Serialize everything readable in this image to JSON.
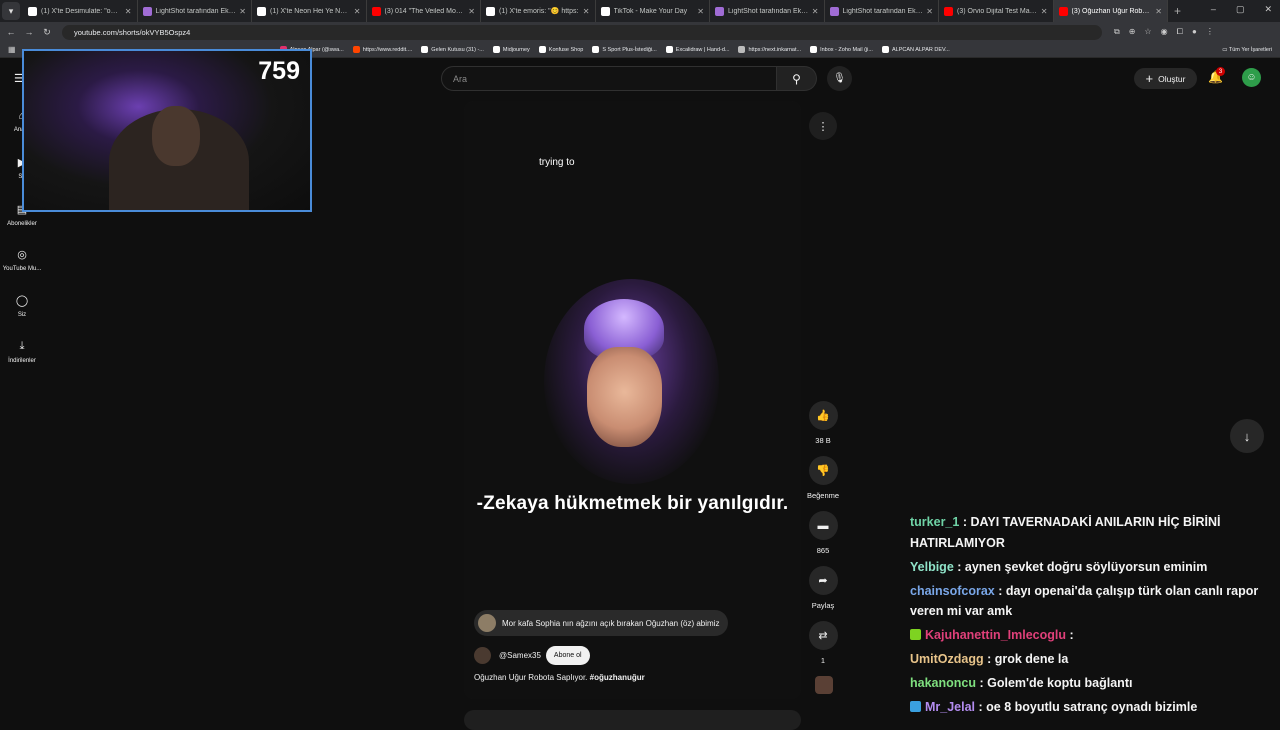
{
  "browser": {
    "tabs": [
      {
        "title": "(1) X'te Desimulate: \"omw fr\"",
        "color": "#ffffff",
        "active": false
      },
      {
        "title": "LightShot tarafından Ekran Gö",
        "color": "#a06cd5",
        "active": false
      },
      {
        "title": "(1) X'te Neon Hei Ye Neon \"",
        "color": "#ffffff",
        "active": false
      },
      {
        "title": "(3) 014 \"The Veiled Monolith\"",
        "color": "#ff0000",
        "active": false
      },
      {
        "title": "(1) X'te emoris: \"😊 https:",
        "color": "#ffffff",
        "active": false
      },
      {
        "title": "TikTok - Make Your Day",
        "color": "#ffffff",
        "active": false
      },
      {
        "title": "LightShot tarafından Ekran Gö",
        "color": "#a06cd5",
        "active": false
      },
      {
        "title": "LightShot tarafından Ekran Gö",
        "color": "#a06cd5",
        "active": false
      },
      {
        "title": "(3) Orvio Dijital Test Makinesi",
        "color": "#ff0000",
        "active": false
      },
      {
        "title": "(3) Oğuzhan Uğur Robota Sap",
        "color": "#ff0000",
        "active": true
      }
    ],
    "url": "youtube.com/shorts/okVYB5Ospz4",
    "bookmarks": [
      {
        "label": "Alpcan Alpar (@swa...",
        "color": "#e1306c"
      },
      {
        "label": "https://www.reddit....",
        "color": "#ff4500"
      },
      {
        "label": "Gelen Kutusu (31) -...",
        "color": "#ffffff"
      },
      {
        "label": "Midjourney",
        "color": "#ffffff"
      },
      {
        "label": "Konfuse Shop",
        "color": "#ffffff"
      },
      {
        "label": "S Sport Plus-İstediği...",
        "color": "#ffffff"
      },
      {
        "label": "Excalidraw | Hand-d...",
        "color": "#ffffff"
      },
      {
        "label": "https://next.inkarnat...",
        "color": "#bbbbbb"
      },
      {
        "label": "Inbox - Zoho Mail (ji...",
        "color": "#ffffff"
      },
      {
        "label": "ALPCAN ALPAR DEV...",
        "color": "#ffffff"
      }
    ],
    "all_bookmarks": "Tüm Yer İşaretleri"
  },
  "sidebar": {
    "items": [
      {
        "label": "Ana S",
        "icon": "home-icon"
      },
      {
        "label": "Sh",
        "icon": "shorts-icon"
      },
      {
        "label": "Abonelikler",
        "icon": "subscriptions-icon"
      },
      {
        "label": "YouTube Mu...",
        "icon": "youtube-music-icon"
      },
      {
        "label": "Siz",
        "icon": "account-icon"
      },
      {
        "label": "İndirilenler",
        "icon": "download-icon"
      }
    ]
  },
  "webcam": {
    "counter": "759"
  },
  "header": {
    "search_placeholder": "Ara",
    "create_label": "Oluştur",
    "notification_count": "3"
  },
  "short": {
    "caption_top": "trying to",
    "subtitle": "-Zekaya hükmetmek bir yanılgıdır.",
    "pill_text": "Mor kafa Sophia nın ağzını açık bırakan Oğuzhan (öz) abimiz",
    "channel": "@Samex35",
    "subscribe_label": "Abone ol",
    "desc_text": "Oğuzhan Uğur Robota Saplıyor. ",
    "desc_tag": "#oğuzhanuğur"
  },
  "actions": {
    "likes": "38 B",
    "dislike_label": "Beğenme",
    "comments": "865",
    "share_label": "Paylaş",
    "remix_count": "1"
  },
  "chat": [
    {
      "user": "turker_1",
      "color": "#6fd3a6",
      "text": " : DAYI TAVERNADAKİ ANILARIN HİÇ BİRİNİ HATIRLAMIYOR",
      "badge": ""
    },
    {
      "user": "Yelbige",
      "color": "#8fe3c8",
      "text": " : aynen şevket doğru söylüyorsun eminim",
      "badge": ""
    },
    {
      "user": "chainsofcorax",
      "color": "#7aa7e8",
      "text": " : dayı openai'da çalışıp türk olan canlı rapor veren mi var amk",
      "badge": ""
    },
    {
      "user": "Kajuhanettin_Imlecoglu",
      "color": "#e0407a",
      "text": " : ",
      "badge": "#7ed321"
    },
    {
      "user": "UmitOzdagg",
      "color": "#e8c48a",
      "text": " : grok dene la",
      "badge": ""
    },
    {
      "user": "hakanoncu",
      "color": "#7fe07f",
      "text": " : Golem'de koptu bağlantı",
      "badge": ""
    },
    {
      "user": "Mr_Jelal",
      "color": "#b38cf0",
      "text": " : oe 8 boyutlu satranç oynadı bizimle",
      "badge": "#3aa0e0"
    }
  ]
}
